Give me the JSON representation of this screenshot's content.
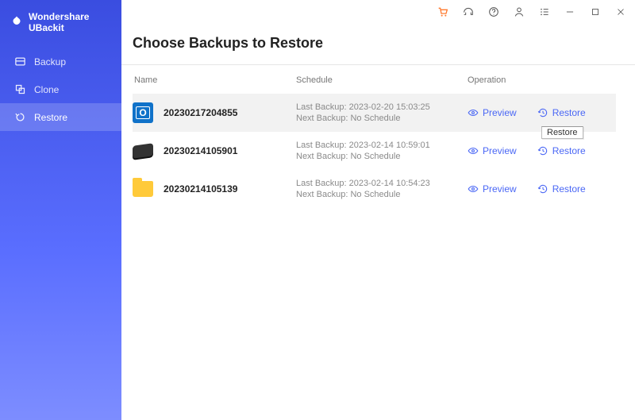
{
  "app_name": "Wondershare UBackit",
  "sidebar": {
    "items": [
      {
        "label": "Backup"
      },
      {
        "label": "Clone"
      },
      {
        "label": "Restore"
      }
    ]
  },
  "page": {
    "title": "Choose Backups to Restore"
  },
  "columns": {
    "name": "Name",
    "schedule": "Schedule",
    "operation": "Operation"
  },
  "op_labels": {
    "preview": "Preview",
    "restore": "Restore"
  },
  "tooltip": "Restore",
  "backups": [
    {
      "icon": "outlook",
      "name": "20230217204855",
      "last": "Last Backup: 2023-02-20 15:03:25",
      "next": "Next Backup: No Schedule"
    },
    {
      "icon": "disk",
      "name": "20230214105901",
      "last": "Last Backup: 2023-02-14 10:59:01",
      "next": "Next Backup: No Schedule"
    },
    {
      "icon": "folder",
      "name": "20230214105139",
      "last": "Last Backup: 2023-02-14 10:54:23",
      "next": "Next Backup: No Schedule"
    }
  ]
}
